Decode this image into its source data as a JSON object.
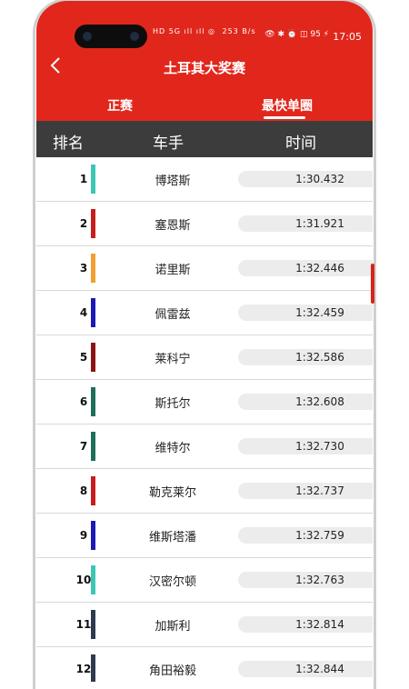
{
  "status_bar": {
    "left_icons": "HD 5G ıll ıll ◎",
    "speed": "253 B/s",
    "right_icons": "👁 ✱ ⏰ ◫ 95 ⚡",
    "time": "17:05"
  },
  "header": {
    "title": "土耳其大奖赛",
    "tabs": [
      {
        "label": "正赛",
        "active": false
      },
      {
        "label": "最快单圈",
        "active": true
      }
    ]
  },
  "columns": {
    "rank": "排名",
    "driver": "车手",
    "time": "时间"
  },
  "rows": [
    {
      "rank": "1",
      "driver": "博塔斯",
      "time": "1:30.432",
      "color": "#3cc6b4"
    },
    {
      "rank": "2",
      "driver": "塞恩斯",
      "time": "1:31.921",
      "color": "#c81e1e"
    },
    {
      "rank": "3",
      "driver": "诺里斯",
      "time": "1:32.446",
      "color": "#f0a030"
    },
    {
      "rank": "4",
      "driver": "佩雷兹",
      "time": "1:32.459",
      "color": "#1a1ab4"
    },
    {
      "rank": "5",
      "driver": "莱科宁",
      "time": "1:32.586",
      "color": "#8c1414"
    },
    {
      "rank": "6",
      "driver": "斯托尔",
      "time": "1:32.608",
      "color": "#1e6e5a"
    },
    {
      "rank": "7",
      "driver": "维特尔",
      "time": "1:32.730",
      "color": "#1e6e5a"
    },
    {
      "rank": "8",
      "driver": "勒克莱尔",
      "time": "1:32.737",
      "color": "#c81e1e"
    },
    {
      "rank": "9",
      "driver": "维斯塔潘",
      "time": "1:32.759",
      "color": "#1a1ab4"
    },
    {
      "rank": "10",
      "driver": "汉密尔顿",
      "time": "1:32.763",
      "color": "#3cc6b4"
    },
    {
      "rank": "11",
      "driver": "加斯利",
      "time": "1:32.814",
      "color": "#2e3a50"
    },
    {
      "rank": "12",
      "driver": "角田裕毅",
      "time": "1:32.844",
      "color": "#2e3a50"
    }
  ],
  "colors": {
    "header_red": "#e1271c",
    "column_header": "#3c3c3c"
  }
}
